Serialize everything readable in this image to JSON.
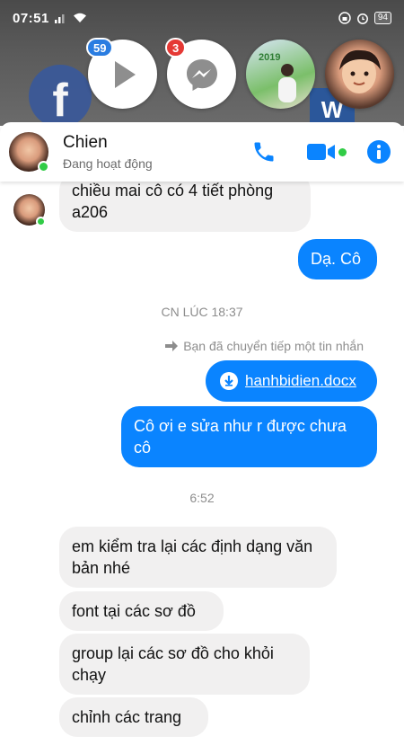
{
  "status_bar": {
    "time": "07:51",
    "battery": "94"
  },
  "chat_heads": {
    "video_badge": "59",
    "messenger_badge": "3",
    "photo_text": "2019"
  },
  "header": {
    "name": "Chien",
    "status": "Đang hoạt động"
  },
  "messages": {
    "m1": "chiều mai cô có 4 tiết phòng a206",
    "m2": "Dạ. Cô",
    "timestamp1": "CN LÚC 18:37",
    "forward_note": "Bạn đã chuyển tiếp một tin nhắn",
    "file_name": "hanhbidien.docx",
    "m3": "Cô ơi e sửa như r được chưa cô",
    "timestamp2": "6:52",
    "m4": "em kiểm tra lại các định dạng văn bản nhé",
    "m5": "font tại các sơ đồ",
    "m6": "group lại các sơ đồ cho khỏi chạy",
    "m7": "chỉnh các trang"
  },
  "colors": {
    "accent": "#0a84ff",
    "incoming_bubble": "#f1f0f0",
    "online": "#31cc46"
  }
}
